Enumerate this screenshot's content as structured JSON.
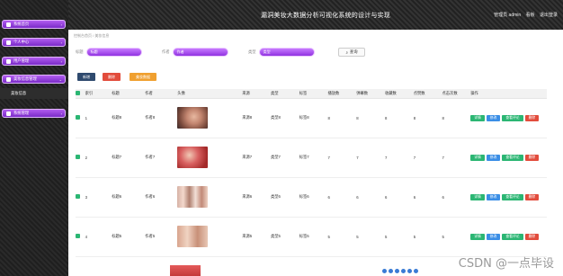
{
  "header": {
    "title": "漏洞美妆大数据分析可视化系统的设计与实现",
    "user": "管理员 admin",
    "links": [
      "看板",
      "退出登录"
    ]
  },
  "sidebar": {
    "items": [
      {
        "label": "系统首页"
      },
      {
        "label": "个人中心"
      },
      {
        "label": "用户管理"
      },
      {
        "label": "美妆信息管理"
      }
    ],
    "submenu": "美妆信息",
    "items2": [
      {
        "label": "系统管理"
      }
    ]
  },
  "breadcrumb": "控制台首页 / 美妆信息",
  "search": {
    "f1_label": "标题",
    "f1_placeholder": "标题",
    "f2_label": "作者",
    "f2_placeholder": "作者",
    "f3_label": "类型",
    "f3_placeholder": "类型",
    "button": "查询"
  },
  "actions": {
    "add": "新增",
    "delete": "删除",
    "report": "美妆数据"
  },
  "table": {
    "headers": [
      "索引",
      "标题",
      "作者",
      "头像",
      "来源",
      "类型",
      "标签",
      "播放数",
      "弹幕数",
      "收藏数",
      "点赞数",
      "点击次数",
      "操作"
    ],
    "rows": [
      [
        "1",
        "标题8",
        "作者8",
        "",
        "来源8",
        "类型8",
        "标签8",
        "8",
        "8",
        "8",
        "8",
        "8"
      ],
      [
        "2",
        "标题7",
        "作者7",
        "",
        "来源7",
        "类型7",
        "标签7",
        "7",
        "7",
        "7",
        "7",
        "7"
      ],
      [
        "3",
        "标题6",
        "作者6",
        "",
        "来源6",
        "类型6",
        "标签6",
        "6",
        "6",
        "6",
        "6",
        "6"
      ],
      [
        "4",
        "标题5",
        "作者5",
        "",
        "来源5",
        "类型5",
        "标签5",
        "5",
        "5",
        "5",
        "5",
        "5"
      ]
    ],
    "row_ops": [
      "详情",
      "修改",
      "查看评论",
      "删除"
    ]
  },
  "watermark": "CSDN @一点毕设",
  "colors": {
    "accent": "#9b40e8",
    "green": "#2bb673",
    "blue": "#3a8ee6",
    "red": "#e24c3c",
    "orange": "#f0a030",
    "navy": "#2f4a6e"
  }
}
